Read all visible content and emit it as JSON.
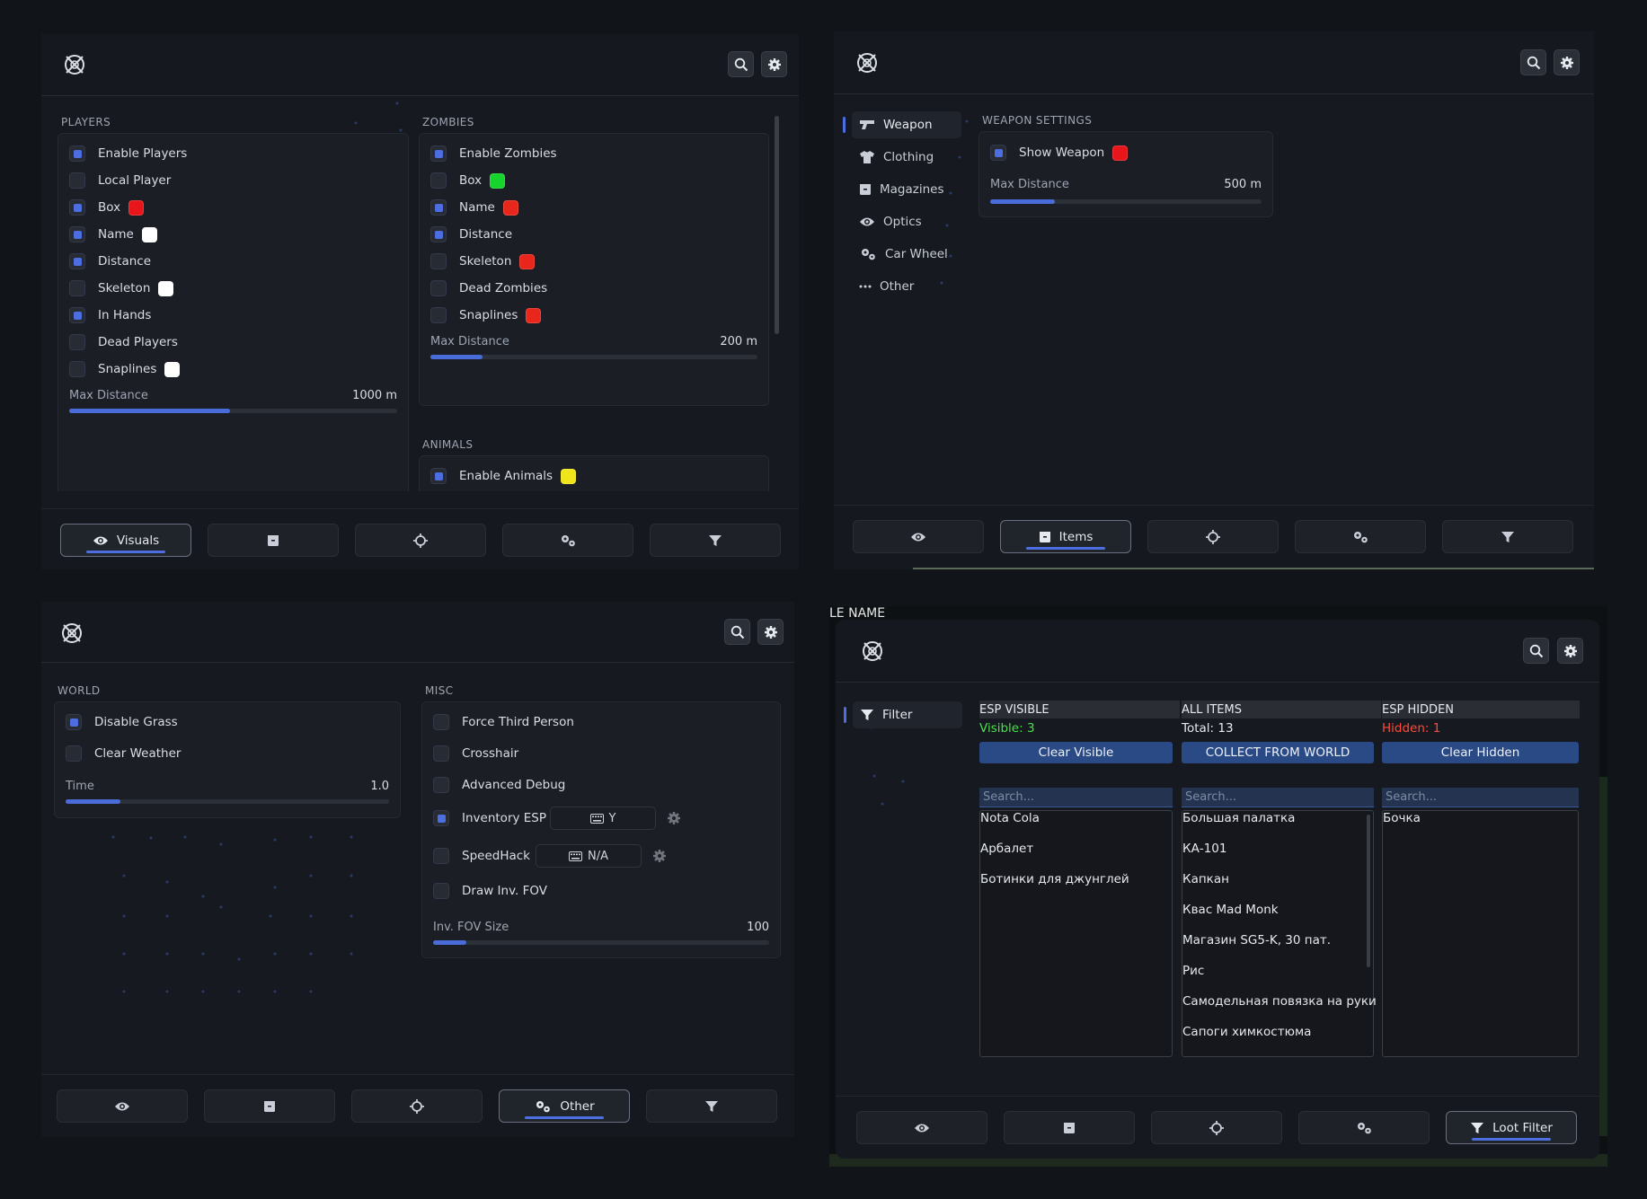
{
  "tabs": {
    "visuals": "Visuals",
    "items": "Items",
    "other": "Other",
    "loot_filter": "Loot Filter"
  },
  "panel1": {
    "players": {
      "title": "PLAYERS",
      "options": [
        {
          "label": "Enable Players",
          "checked": true
        },
        {
          "label": "Local Player",
          "checked": false
        },
        {
          "label": "Box",
          "checked": true,
          "color": "#e8161b"
        },
        {
          "label": "Name",
          "checked": true,
          "color": "#ffffff"
        },
        {
          "label": "Distance",
          "checked": true
        },
        {
          "label": "Skeleton",
          "checked": false,
          "color": "#ffffff"
        },
        {
          "label": "In Hands",
          "checked": true
        },
        {
          "label": "Dead Players",
          "checked": false
        },
        {
          "label": "Snaplines",
          "checked": false,
          "color": "#ffffff"
        }
      ],
      "slider_label": "Max Distance",
      "slider_value": "1000 m",
      "slider_fraction": 0.49
    },
    "zombies": {
      "title": "ZOMBIES",
      "options": [
        {
          "label": "Enable Zombies",
          "checked": true
        },
        {
          "label": "Box",
          "checked": false,
          "color": "#16d42c"
        },
        {
          "label": "Name",
          "checked": true,
          "color": "#e8261b"
        },
        {
          "label": "Distance",
          "checked": true
        },
        {
          "label": "Skeleton",
          "checked": false,
          "color": "#e8261b"
        },
        {
          "label": "Dead Zombies",
          "checked": false
        },
        {
          "label": "Snaplines",
          "checked": false,
          "color": "#e8261b"
        }
      ],
      "slider_label": "Max Distance",
      "slider_value": "200 m",
      "slider_fraction": 0.16
    },
    "animals": {
      "title": "ANIMALS",
      "options": [
        {
          "label": "Enable Animals",
          "checked": true,
          "color": "#f0e41a"
        }
      ]
    }
  },
  "panel2": {
    "nav": [
      "Weapon",
      "Clothing",
      "Magazines",
      "Optics",
      "Car Wheel",
      "Other"
    ],
    "section_title": "WEAPON SETTINGS",
    "show_weapon": {
      "label": "Show Weapon",
      "checked": true,
      "color": "#e8161b"
    },
    "slider_label": "Max Distance",
    "slider_value": "500 m",
    "slider_fraction": 0.24
  },
  "panel3": {
    "world": {
      "title": "WORLD",
      "options": [
        {
          "label": "Disable Grass",
          "checked": true
        },
        {
          "label": "Clear Weather",
          "checked": false
        }
      ],
      "slider_label": "Time",
      "slider_value": "1.0",
      "slider_fraction": 0.17
    },
    "misc": {
      "title": "MISC",
      "options": [
        {
          "label": "Force Third Person",
          "checked": false
        },
        {
          "label": "Crosshair",
          "checked": false
        },
        {
          "label": "Advanced Debug",
          "checked": false
        },
        {
          "label": "Inventory ESP",
          "checked": true,
          "key": "Y"
        },
        {
          "label": "SpeedHack",
          "checked": false,
          "key": "N/A"
        },
        {
          "label": "Draw Inv. FOV",
          "checked": false
        }
      ],
      "slider_label": "Inv. FOV Size",
      "slider_value": "100",
      "slider_fraction": 0.1
    }
  },
  "panel4": {
    "bg_text_top": "LE NAME",
    "nav": [
      "Filter"
    ],
    "columns": [
      {
        "header": "ESP VISIBLE",
        "status": "Visible: 3",
        "status_color": "#49e24a",
        "button": "Clear Visible",
        "search_placeholder": "Search...",
        "items": [
          "Nota Cola",
          "Арбалет",
          "Ботинки для джунглей"
        ]
      },
      {
        "header": "ALL ITEMS",
        "status": "Total: 13",
        "status_color": "#e6e9ee",
        "button": "COLLECT FROM WORLD",
        "search_placeholder": "Search...",
        "items": [
          "Большая палатка",
          "КА-101",
          "Капкан",
          "Квас Mad Monk",
          "Магазин SG5-K, 30 пат.",
          "Рис",
          "Самодельная повязка на руки",
          "Сапоги химкостюма"
        ]
      },
      {
        "header": "ESP HIDDEN",
        "status": "Hidden: 1",
        "status_color": "#ff4a3a",
        "button": "Clear Hidden",
        "search_placeholder": "Search...",
        "items": [
          "Бочка"
        ]
      }
    ]
  }
}
